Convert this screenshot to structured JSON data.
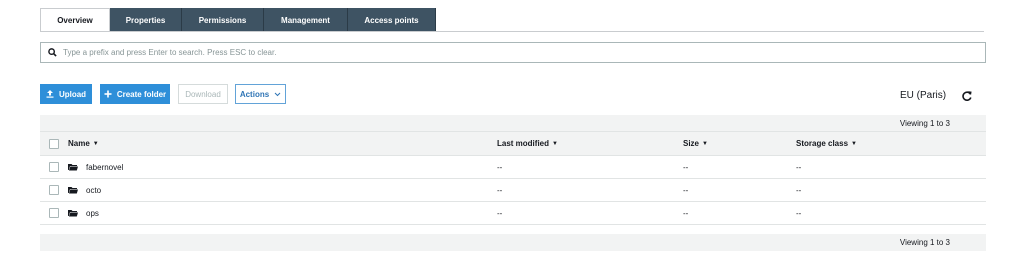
{
  "tabs": [
    {
      "label": "Overview",
      "active": true
    },
    {
      "label": "Properties",
      "active": false
    },
    {
      "label": "Permissions",
      "active": false
    },
    {
      "label": "Management",
      "active": false
    },
    {
      "label": "Access points",
      "active": false
    }
  ],
  "search": {
    "placeholder": "Type a prefix and press Enter to search. Press ESC to clear.",
    "value": ""
  },
  "toolbar": {
    "upload_label": "Upload",
    "create_folder_label": "Create folder",
    "download_label": "Download",
    "actions_label": "Actions"
  },
  "region": "EU (Paris)",
  "viewing_text": "Viewing 1 to 3",
  "table": {
    "headers": {
      "name": "Name",
      "last_modified": "Last modified",
      "size": "Size",
      "storage_class": "Storage class"
    },
    "rows": [
      {
        "name": "fabernovel",
        "last_modified": "--",
        "size": "--",
        "storage_class": "--"
      },
      {
        "name": "octo",
        "last_modified": "--",
        "size": "--",
        "storage_class": "--"
      },
      {
        "name": "ops",
        "last_modified": "--",
        "size": "--",
        "storage_class": "--"
      }
    ]
  },
  "colors": {
    "tab_bg": "#3e5363",
    "primary": "#2e8fd9",
    "table_header_bg": "#f2f3f3"
  },
  "icons": {
    "search": "search-icon",
    "upload": "upload-icon",
    "add": "plus-icon",
    "refresh": "refresh-icon",
    "folder": "folder-icon"
  }
}
